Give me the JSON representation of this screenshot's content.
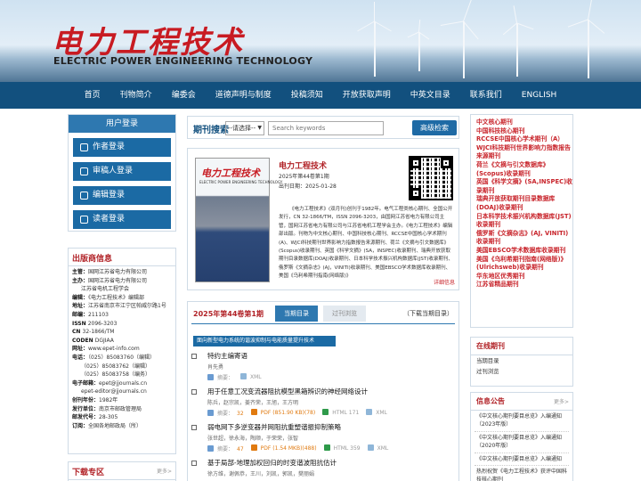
{
  "header": {
    "logo_cn": "电力工程技术",
    "logo_en": "ELECTRIC POWER ENGINEERING TECHNOLOGY"
  },
  "nav": [
    "首页",
    "刊物简介",
    "编委会",
    "道德声明与制度",
    "投稿须知",
    "开放获取声明",
    "中英文目录",
    "联系我们",
    "ENGLISH"
  ],
  "login": {
    "title": "用户登录",
    "buttons": [
      "作者登录",
      "审稿人登录",
      "编辑登录",
      "读者登录"
    ]
  },
  "publisher": {
    "title": "出版商信息",
    "rows": [
      {
        "k": "主管：",
        "v": "国网江苏省电力有限公司"
      },
      {
        "k": "主办：",
        "v": "国网江苏省电力有限公司"
      },
      {
        "k": "",
        "v": "江苏省电机工程学会"
      },
      {
        "k": "编辑：",
        "v": "《电力工程技术》编辑部"
      },
      {
        "k": "地址：",
        "v": "江苏省南京市江宁区帕威尔路1号"
      },
      {
        "k": "邮编：",
        "v": "211103"
      },
      {
        "k": "ISSN ",
        "v": "2096-3203"
      },
      {
        "k": "CN ",
        "v": "32-1866/TM"
      },
      {
        "k": "CODEN ",
        "v": "DGJIAA"
      },
      {
        "k": "网址：",
        "v": "www.epet-info.com"
      },
      {
        "k": "电话：",
        "v": "（025）85083760（编辑）"
      },
      {
        "k": "",
        "v": "（025）85083762（编辑）"
      },
      {
        "k": "",
        "v": "（025）85083758（编务）"
      },
      {
        "k": "电子邮箱：",
        "v": "epet@jjournals.cn"
      },
      {
        "k": "",
        "v": "epet-editor@jjournals.cn"
      },
      {
        "k": "创刊年份：",
        "v": "1982年"
      },
      {
        "k": "发行单位：",
        "v": "南京市邮政管理局"
      },
      {
        "k": "邮发代号：",
        "v": "28-305"
      },
      {
        "k": "订阅：",
        "v": "全国各地邮政局（所）"
      }
    ]
  },
  "download": {
    "title": "下载专区",
    "more": "更多>"
  },
  "search": {
    "label": "期刊搜索",
    "select": "--请选择--",
    "placeholder": "Search keywords",
    "button": "高级检索"
  },
  "journal": {
    "cover_title": "电力工程技术",
    "cover_sub": "ELECTRIC POWER ENGINEERING TECHNOLOGY",
    "name": "电力工程技术",
    "issue": "2025年第44卷第1期",
    "date": "出刊日期：2025-01-28",
    "desc": "《电力工程技术》(双月刊)创刊于1982年。电气工程类核心期刊、全国公开发行，CN 32-1866/TM，ISSN 2096-3203，由国网江苏省电力有限公司主管，国网江苏省电力有限公司与江苏省电机工程学会主办。《电力工程技术》编辑部出版。刊物为中文核心期刊、中国科技核心期刊、RCCSE中国核心学术期刊(A)、WJCI科技期刊世界影响力指数报告来源期刊、荷兰《文摘与引文数据库》(Scopus)收录期刊、英国《科学文摘》(SA，INSPEC)收录期刊、瑞典开放获取期刊目录数据库(DOAJ)收录期刊、日本科学技术振兴机构数据库(JST)收录期刊、俄罗斯《文摘杂志》(AJ，VINITI)收录期刊、美国EBSCO学术数据库收录期刊、美国《乌利希期刊指南(网络版)》",
    "more": "详细信息"
  },
  "issue": {
    "title": "2025年第44卷第1期",
    "tab_current": "当期目录",
    "tab_past": "过刊浏览",
    "download": "（下载当期目录）",
    "section": "面向新型电力系统的谐波抑制与电能质量提升技术",
    "articles": [
      {
        "title": "特约主编寄语",
        "authors": "肖先勇",
        "browse": "",
        "pdf": "",
        "html": ""
      },
      {
        "title": "用于任意工况变流器阻抗模型黑箱辨识的神经网络设计",
        "authors": "陈兵，赵宗凯，姜齐荣，王旭，王方明",
        "browse": "32",
        "pdf": "PDF (851.90 KB)(78)",
        "html": "HTML 171"
      },
      {
        "title": "弱电网下多逆变器并网阻抗重塑谐振抑制策略",
        "authors": "张世超，徐永海，陶顺，于荣荣，张智",
        "browse": "47",
        "pdf": "PDF (1.54 MKB)(488)",
        "html": "HTML 359"
      },
      {
        "title": "基于局部-地理加权回归的时变谐波阻抗估计",
        "authors": "徐方维，谢佩恭，王川，刘凯，郭凯，樊丽娟",
        "browse": "29",
        "pdf": "PDF (2.43 MKB)(78)",
        "html": "HTML 192"
      }
    ],
    "labels": {
      "browse": "摘要：",
      "xml": "XML"
    }
  },
  "index_list": [
    "中文核心期刊",
    "中国科技核心期刊",
    "RCCSE中国核心学术期刊（A）",
    "WJCI科技期刊世界影响力指数报告来源期刊",
    "荷兰《文摘与引文数据库》(Scopus)收录期刊",
    "英国《科学文摘》(SA,INSPEC)收录期刊",
    "瑞典开放获取期刊目录数据库(DOAJ)收录期刊",
    "日本科学技术振兴机构数据库(JST)收录期刊",
    "俄罗斯《文摘杂志》(AJ, VINITI)收录期刊",
    "美国EBSCO学术数据库收录期刊",
    "美国《乌利希期刊指南(网络版)》(Ulrichsweb)收录期刊",
    "华东地区优秀期刊",
    "江苏省精品期刊"
  ],
  "online": {
    "title": "在线期刊",
    "links": [
      "当期目录",
      "过刊浏览"
    ]
  },
  "notices": {
    "title": "信息公告",
    "more": "更多>",
    "items": [
      "《中文核心期刊要目总览》入编通知（2023年版）",
      "《中文核心期刊要目总览》入编通知（2020年版）",
      "《中文核心期刊要目总览》入编通知",
      "热烈祝贺《电力工程技术》获评中国科技核心期刊"
    ]
  }
}
